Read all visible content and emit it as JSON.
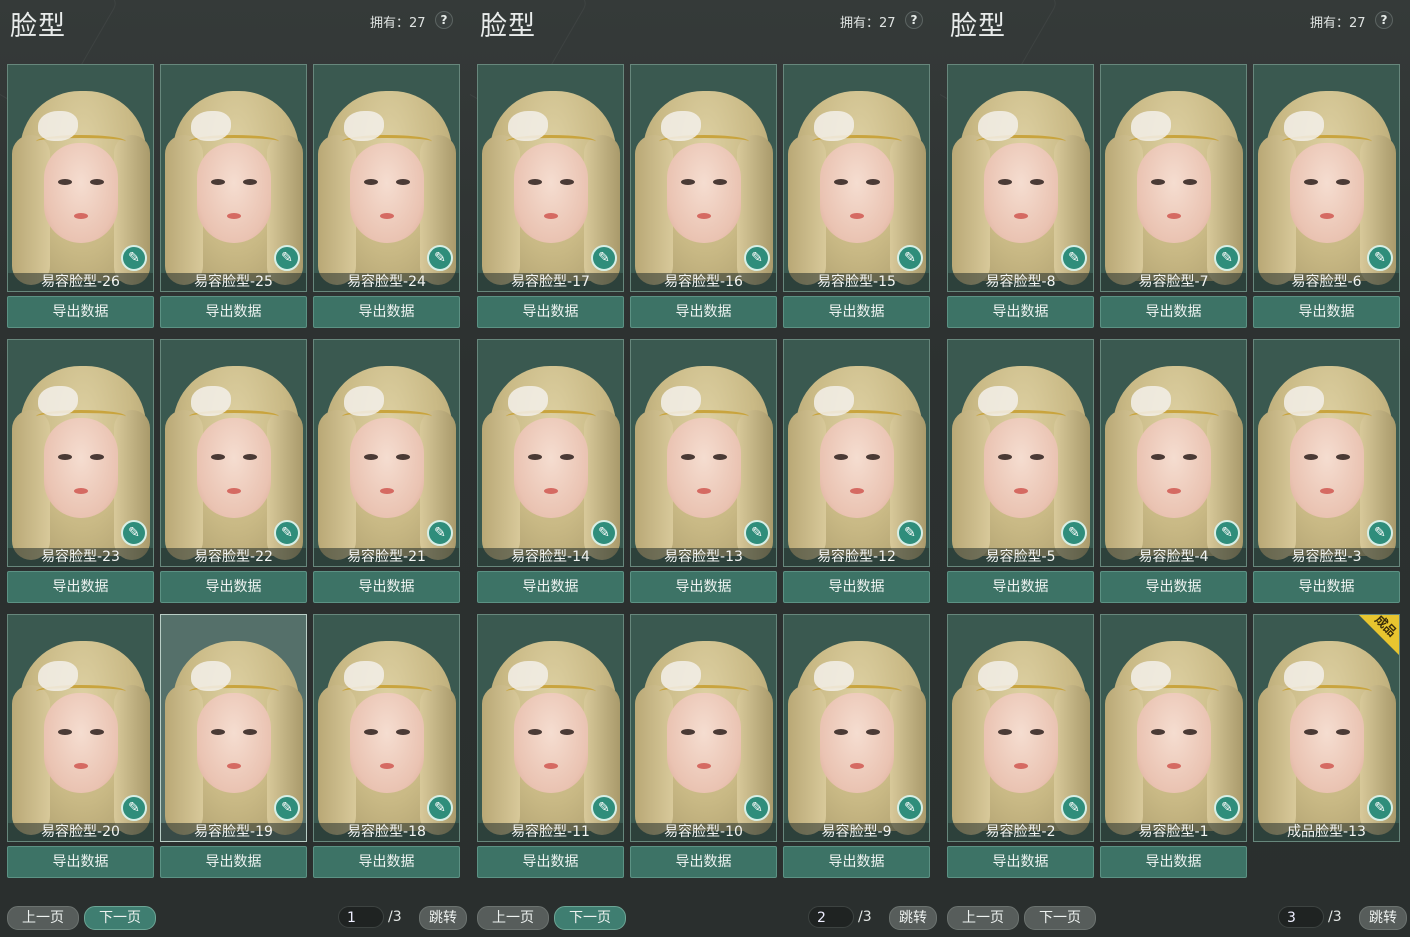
{
  "panels": [
    {
      "title": "脸型",
      "owned": "拥有：27",
      "help": "?",
      "cards": [
        {
          "label": "易容脸型-26",
          "export": "导出数据"
        },
        {
          "label": "易容脸型-25",
          "export": "导出数据"
        },
        {
          "label": "易容脸型-24",
          "export": "导出数据"
        },
        {
          "label": "易容脸型-23",
          "export": "导出数据"
        },
        {
          "label": "易容脸型-22",
          "export": "导出数据"
        },
        {
          "label": "易容脸型-21",
          "export": "导出数据"
        },
        {
          "label": "易容脸型-20",
          "export": "导出数据"
        },
        {
          "label": "易容脸型-19",
          "export": "导出数据",
          "selected": true
        },
        {
          "label": "易容脸型-18",
          "export": "导出数据"
        }
      ],
      "pager": {
        "prev": "上一页",
        "next": "下一页",
        "page": "1",
        "total": "/3",
        "jump": "跳转",
        "active": "none"
      }
    },
    {
      "title": "脸型",
      "owned": "拥有：27",
      "help": "?",
      "cards": [
        {
          "label": "易容脸型-17",
          "export": "导出数据"
        },
        {
          "label": "易容脸型-16",
          "export": "导出数据"
        },
        {
          "label": "易容脸型-15",
          "export": "导出数据"
        },
        {
          "label": "易容脸型-14",
          "export": "导出数据"
        },
        {
          "label": "易容脸型-13",
          "export": "导出数据"
        },
        {
          "label": "易容脸型-12",
          "export": "导出数据"
        },
        {
          "label": "易容脸型-11",
          "export": "导出数据"
        },
        {
          "label": "易容脸型-10",
          "export": "导出数据"
        },
        {
          "label": "易容脸型-9",
          "export": "导出数据"
        }
      ],
      "pager": {
        "prev": "上一页",
        "next": "下一页",
        "page": "2",
        "total": "/3",
        "jump": "跳转",
        "active": "both"
      }
    },
    {
      "title": "脸型",
      "owned": "拥有：27",
      "help": "?",
      "cards": [
        {
          "label": "易容脸型-8",
          "export": "导出数据"
        },
        {
          "label": "易容脸型-7",
          "export": "导出数据"
        },
        {
          "label": "易容脸型-6",
          "export": "导出数据"
        },
        {
          "label": "易容脸型-5",
          "export": "导出数据"
        },
        {
          "label": "易容脸型-4",
          "export": "导出数据"
        },
        {
          "label": "易容脸型-3",
          "export": "导出数据"
        },
        {
          "label": "易容脸型-2",
          "export": "导出数据"
        },
        {
          "label": "易容脸型-1",
          "export": "导出数据"
        },
        {
          "label": "成品脸型-13",
          "export": "",
          "badge": "成品"
        }
      ],
      "pager": {
        "prev": "上一页",
        "next": "下一页",
        "page": "3",
        "total": "/3",
        "jump": "跳转",
        "active": "prev"
      }
    }
  ],
  "colors": {
    "accent": "#3d7366",
    "card_bg": "#3a5950",
    "badge": "#e8c52f"
  }
}
